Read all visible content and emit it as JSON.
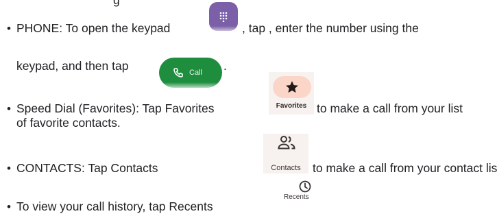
{
  "top_fragment": "g",
  "items": [
    {
      "lines": [
        "PHONE: To open the keypad",
        ", tap , enter the number using the",
        "keypad, and then tap",
        "."
      ],
      "icons": {
        "keypad": "dialpad-icon",
        "call": {
          "icon": "phone-icon",
          "label": "Call"
        }
      }
    },
    {
      "lines": [
        "Speed Dial (Favorites): Tap Favorites",
        "to make a call from your list",
        "of favorite contacts."
      ],
      "icons": {
        "favorites": {
          "icon": "star-icon",
          "label": "Favorites"
        }
      }
    },
    {
      "lines": [
        "CONTACTS: Tap Contacts",
        "to make a call from your contact list."
      ],
      "icons": {
        "contacts": {
          "icon": "people-icon",
          "label": "Contacts"
        }
      }
    },
    {
      "lines": [
        "To view your call history, tap Recents"
      ],
      "icons": {
        "recents": {
          "icon": "clock-icon",
          "label": "Recents"
        }
      }
    }
  ],
  "colors": {
    "keypad_bg": "#7b5fa8",
    "call_bg": "#1e8e3e",
    "favorites_pill": "#fbd5c7",
    "chip_bg": "#f7f1ef",
    "text": "#202124"
  }
}
